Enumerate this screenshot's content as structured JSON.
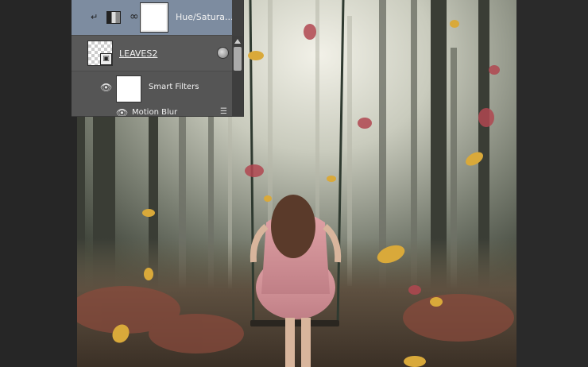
{
  "layers": {
    "hue_layer": {
      "name": "Hue/Satura..."
    },
    "leaves_layer": {
      "name": "LEAVES2"
    },
    "smart_filters": {
      "label": "Smart Filters"
    },
    "motion_blur": {
      "label": "Motion Blur"
    }
  },
  "icons": {
    "visibility": "eye-icon",
    "link": "chain-link-icon",
    "smart_object": "smart-object-badge-icon",
    "adjustment": "hue-saturation-adjustment-icon",
    "filter_options": "filter-blending-options-icon",
    "smart_filter": "smart-filter-icon"
  },
  "colors": {
    "selected_layer": "#7d8ca0",
    "panel": "#535353",
    "window_bg": "#262626"
  }
}
